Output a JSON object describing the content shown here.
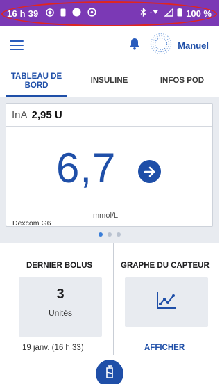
{
  "status_bar": {
    "time": "16 h 39",
    "battery": "100 %",
    "icons": [
      "record-icon",
      "sim-icon",
      "circle-icon",
      "do-not-disturb-icon",
      "bluetooth-icon",
      "wifi-icon",
      "signal-icon",
      "battery-icon"
    ]
  },
  "app_bar": {
    "mode_label": "Manuel",
    "icons": [
      "menu-icon",
      "bell-icon",
      "mode-icon"
    ]
  },
  "tabs": [
    {
      "label": "TABLEAU DE BORD",
      "active": true
    },
    {
      "label": "INSULINE",
      "active": false
    },
    {
      "label": "INFOS POD",
      "active": false
    }
  ],
  "glucose_card": {
    "ina_label": "InA",
    "ina_value": "2,95 U",
    "value": "6,7",
    "unit": "mmol/L",
    "sensor": "Dexcom G6",
    "trend_icon": "arrow-right-icon"
  },
  "pager": {
    "count": 3,
    "active": 0
  },
  "last_bolus": {
    "title": "DERNIER BOLUS",
    "value": "3",
    "unit": "Unités",
    "date": "19 janv. (16 h 33)"
  },
  "sensor_graph": {
    "title": "GRAPHE DU CAPTEUR",
    "button": "AFFICHER",
    "icon": "line-chart-icon"
  },
  "colors": {
    "status_bar": "#7b39b5",
    "accent": "#1f4fa8",
    "panel": "#e8ebf0",
    "highlight": "#e0261f"
  }
}
